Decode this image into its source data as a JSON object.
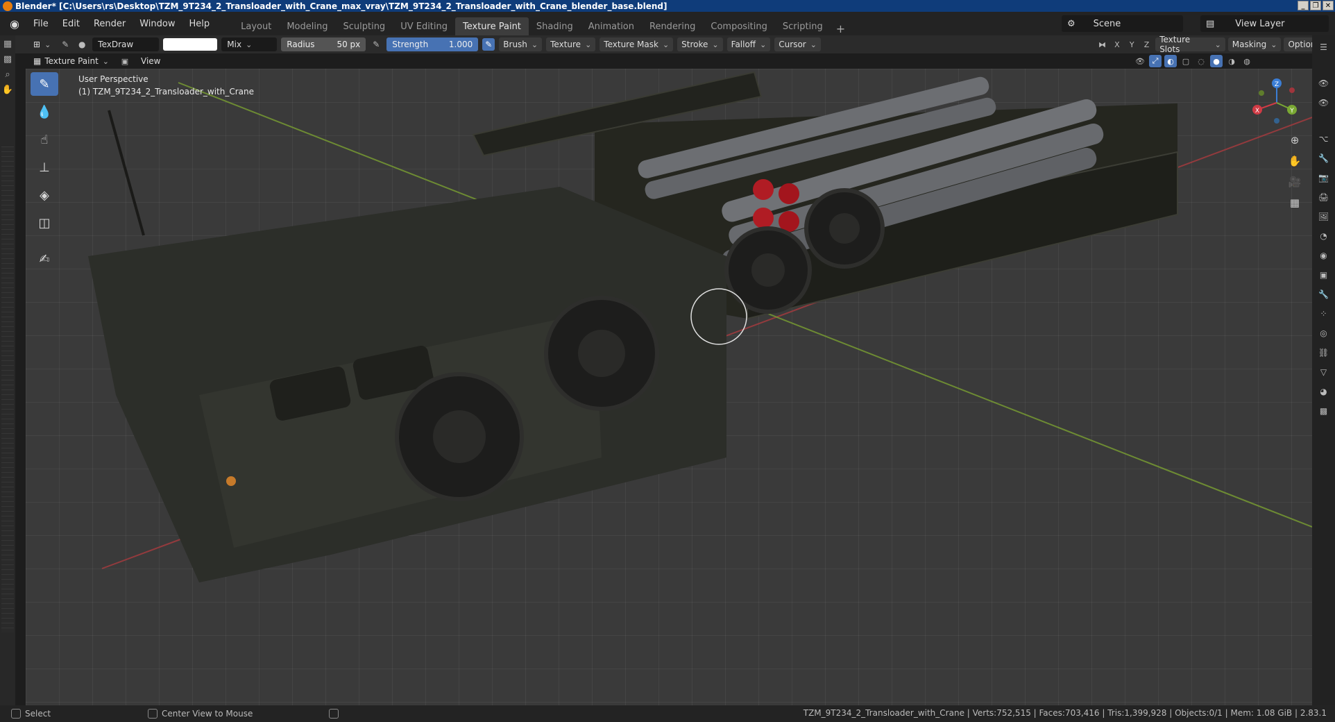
{
  "window": {
    "title": "Blender* [C:\\Users\\rs\\Desktop\\TZM_9T234_2_Transloader_with_Crane_max_vray\\TZM_9T234_2_Transloader_with_Crane_blender_base.blend]"
  },
  "menu": [
    "File",
    "Edit",
    "Render",
    "Window",
    "Help"
  ],
  "workspaces": [
    {
      "label": "Layout",
      "active": false
    },
    {
      "label": "Modeling",
      "active": false
    },
    {
      "label": "Sculpting",
      "active": false
    },
    {
      "label": "UV Editing",
      "active": false
    },
    {
      "label": "Texture Paint",
      "active": true
    },
    {
      "label": "Shading",
      "active": false
    },
    {
      "label": "Animation",
      "active": false
    },
    {
      "label": "Rendering",
      "active": false
    },
    {
      "label": "Compositing",
      "active": false
    },
    {
      "label": "Scripting",
      "active": false
    }
  ],
  "scene": {
    "label": "Scene"
  },
  "view_layer": {
    "label": "View Layer"
  },
  "tool_header": {
    "brush_name": "TexDraw",
    "blend_mode": "Mix",
    "radius_label": "Radius",
    "radius_value": "50 px",
    "strength_label": "Strength",
    "strength_value": "1.000",
    "brush_menu": "Brush",
    "texture_menu": "Texture",
    "texture_mask_menu": "Texture Mask",
    "stroke_menu": "Stroke",
    "falloff_menu": "Falloff",
    "cursor_menu": "Cursor",
    "axis_x": "X",
    "axis_y": "Y",
    "axis_z": "Z",
    "texture_slots_menu": "Texture Slots",
    "masking_menu": "Masking",
    "options_menu": "Options"
  },
  "mode_header": {
    "mode": "Texture Paint",
    "view_menu": "View"
  },
  "viewport": {
    "perspective": "User Perspective",
    "object_info": "(1) TZM_9T234_2_Transloader_with_Crane"
  },
  "gizmo": {
    "x": "X",
    "y": "Y",
    "z": "Z"
  },
  "status": {
    "left_action": "Select",
    "middle_action": "Center View to Mouse",
    "stats": "TZM_9T234_2_Transloader_with_Crane | Verts:752,515 | Faces:703,416 | Tris:1,399,928 | Objects:0/1 | Mem: 1.08 GiB | 2.83.1"
  },
  "colors": {
    "accent": "#4772b3",
    "vehicle_body": "#2c2e29",
    "missile_body": "#6c6e72",
    "missile_cap": "#b01c24",
    "axis_x_line": "#b13a3f",
    "axis_y_line": "#7ea631"
  }
}
